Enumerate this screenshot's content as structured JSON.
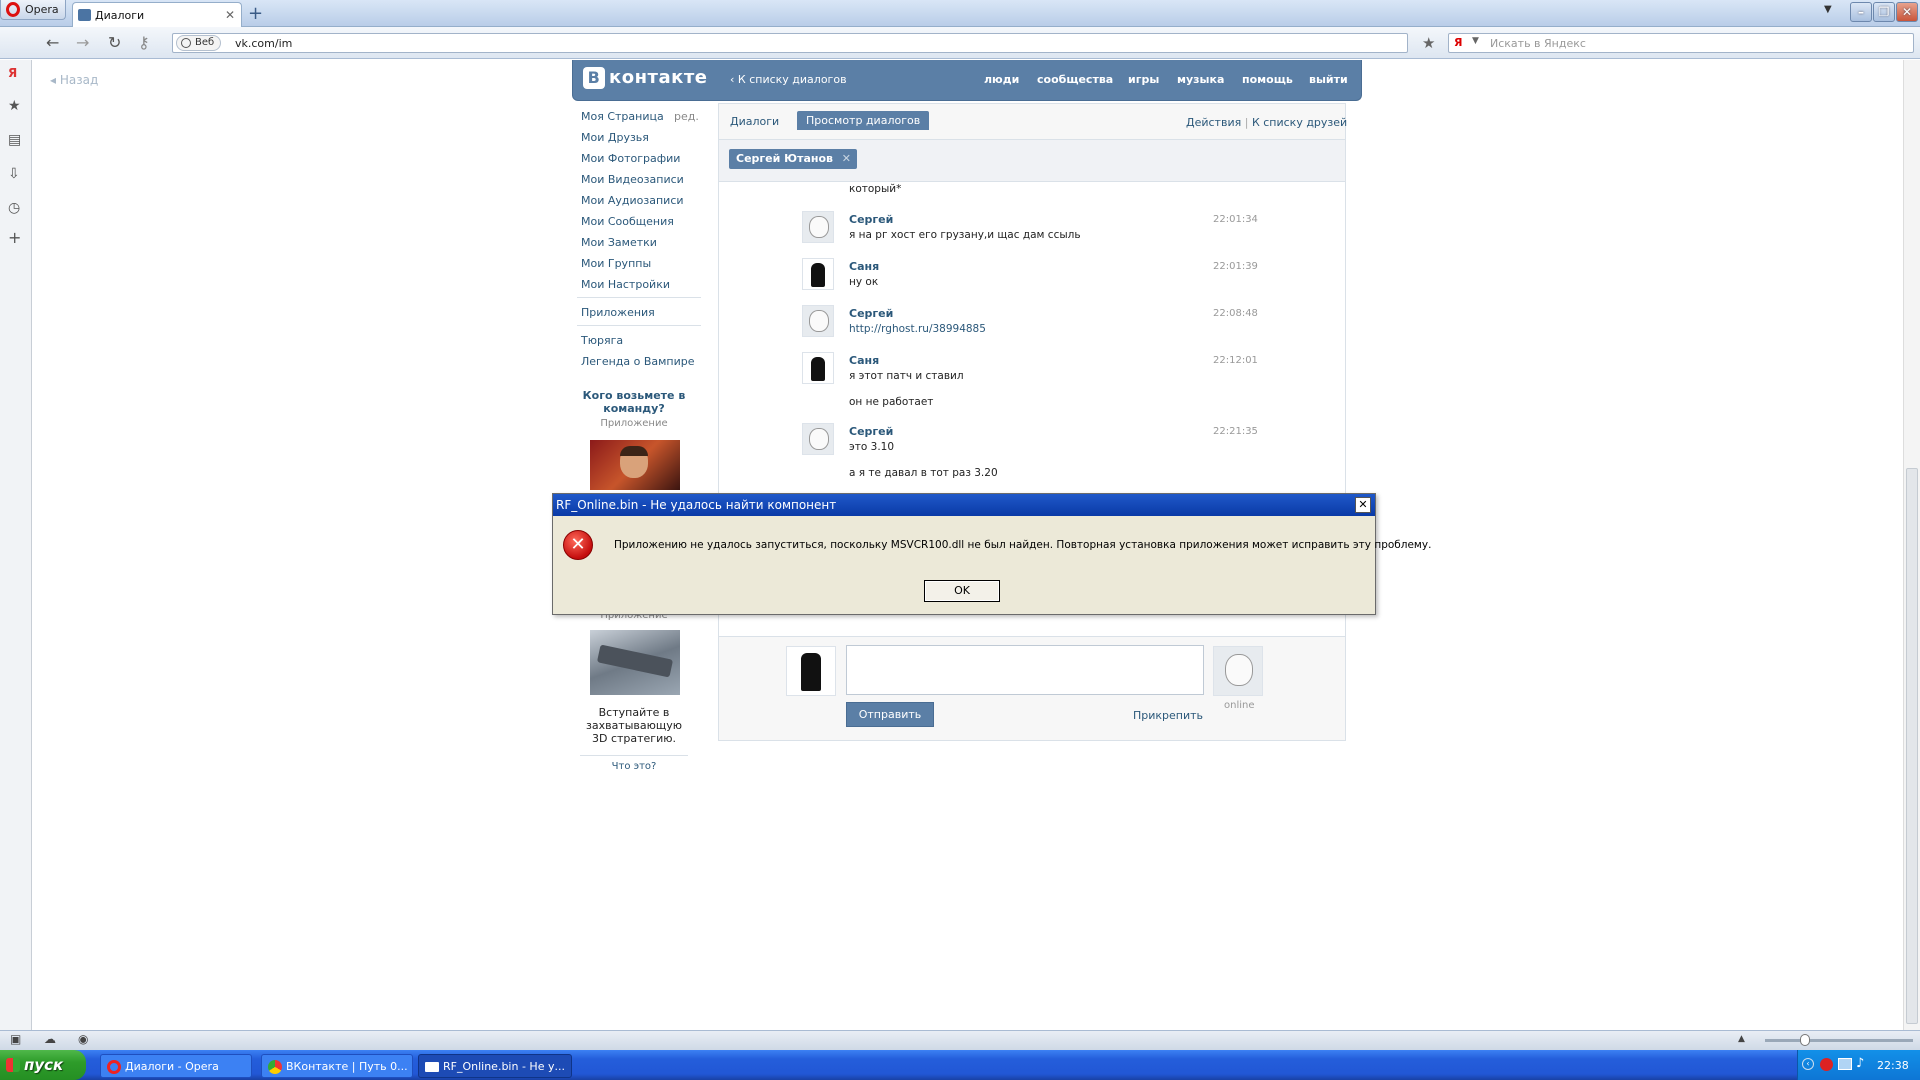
{
  "browser": {
    "menu_label": "Opera",
    "tab_title": "Диалоги",
    "url": "vk.com/im",
    "web_badge": "Веб",
    "search_placeholder": "Искать в Яндекс",
    "search_engine": "Я"
  },
  "page": {
    "back_label": "Назад",
    "vk_logo": "контакте",
    "vk_logo_letter": "В",
    "back_to_dialogs": "К списку диалогов",
    "nav": [
      "люди",
      "сообщества",
      "игры",
      "музыка",
      "помощь",
      "выйти"
    ],
    "left_menu": [
      "Моя Страница",
      "Мои Друзья",
      "Мои Фотографии",
      "Мои Видеозаписи",
      "Мои Аудиозаписи",
      "Мои Сообщения",
      "Мои Заметки",
      "Мои Группы",
      "Мои Настройки"
    ],
    "edit_label": "ред.",
    "apps_label": "Приложения",
    "apps": [
      "Тюряга",
      "Легенда о Вампире"
    ],
    "promo_title": "Кого возьмете в команду?",
    "promo_sub": "Приложение",
    "promo2_sub": "Приложение",
    "promo2_text": "Вступайте в захватывающую 3D стратегию.",
    "what_is_this": "Что это?"
  },
  "dialogs": {
    "tab_dialogs": "Диалоги",
    "tab_view": "Просмотр диалогов",
    "actions": "Действия",
    "to_friends": "К списку друзей",
    "peer": "Сергей Ютанов",
    "fragment": "который*",
    "messages": [
      {
        "name": "Сергей",
        "time": "22:01:34",
        "lines": [
          "я на рг хост его грузану,и щас дам ссыль"
        ],
        "avatar": "meme"
      },
      {
        "name": "Саня",
        "time": "22:01:39",
        "lines": [
          "ну ок"
        ],
        "avatar": "dark"
      },
      {
        "name": "Сергей",
        "time": "22:08:48",
        "lines": [
          "http://rghost.ru/38994885"
        ],
        "avatar": "meme"
      },
      {
        "name": "Саня",
        "time": "22:12:01",
        "lines": [
          "я этот патч и ставил",
          "он не работает"
        ],
        "avatar": "dark"
      },
      {
        "name": "Сергей",
        "time": "22:21:35",
        "lines": [
          "это 3.10",
          "а я те давал в тот раз 3.20"
        ],
        "avatar": "meme"
      }
    ],
    "send_label": "Отправить",
    "attach_label": "Прикрепить",
    "online_label": "online"
  },
  "error_dialog": {
    "title": "RF_Online.bin - Не удалось найти компонент",
    "message": "Приложению не удалось запуститься, поскольку MSVCR100.dll не был найден. Повторная установка приложения может исправить эту проблему.",
    "ok_label": "OK",
    "icon": "error-icon"
  },
  "taskbar": {
    "start_label": "пуск",
    "tasks": [
      "Диалоги - Opera",
      "ВКонтакте | Путь 0...",
      "RF_Online.bin - Не у..."
    ],
    "clock": "22:38"
  },
  "colors": {
    "vk_blue": "#5b7fa6",
    "xp_blue": "#245edb",
    "error_red": "#c40d0d"
  }
}
